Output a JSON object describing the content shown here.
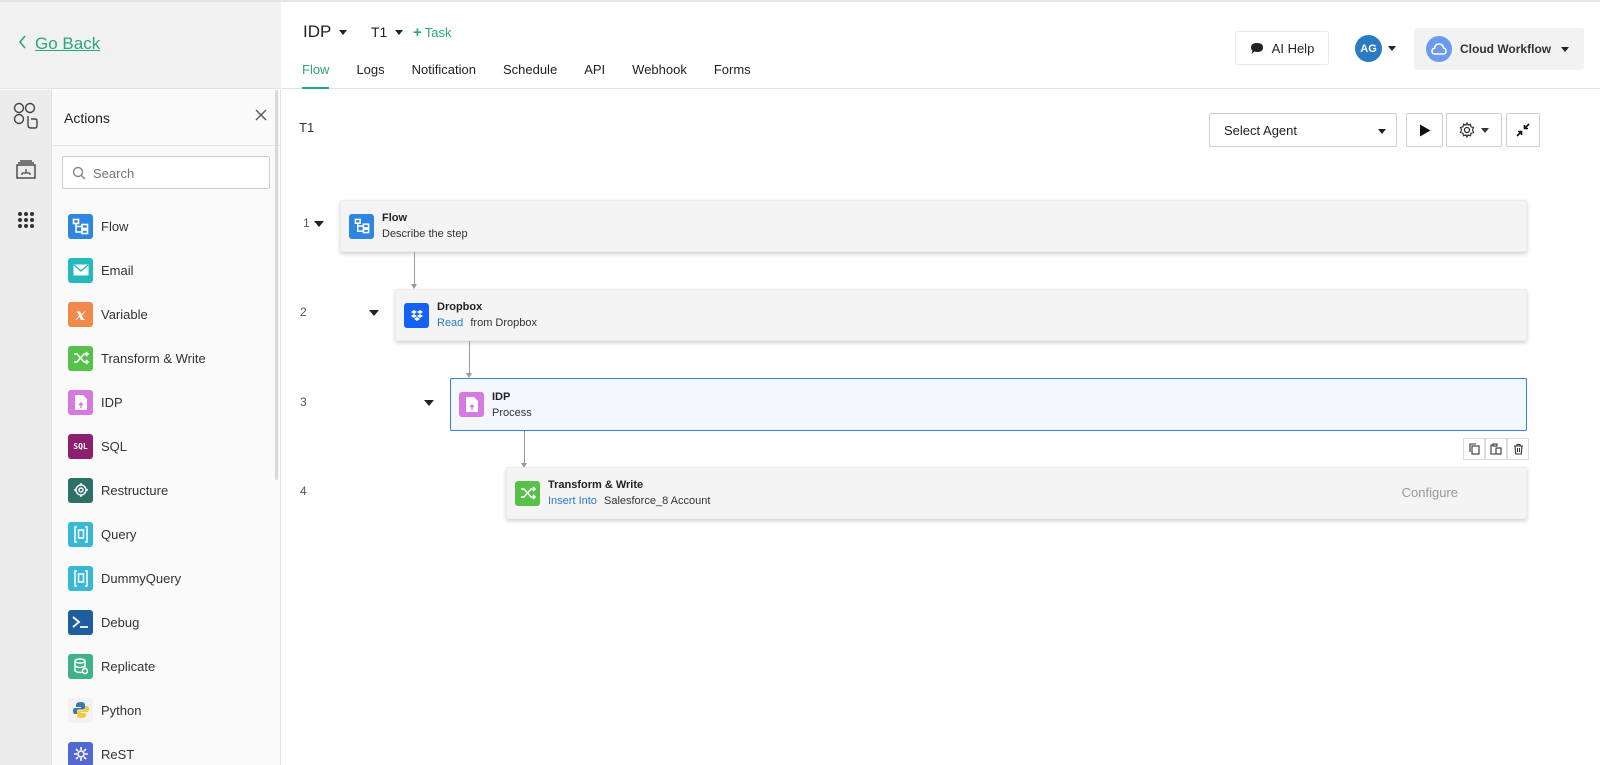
{
  "nav": {
    "go_back": "Go Back"
  },
  "header": {
    "title": "IDP",
    "task_selector": "T1",
    "add_task_label": "Task",
    "tabs": [
      {
        "label": "Flow"
      },
      {
        "label": "Logs"
      },
      {
        "label": "Notification"
      },
      {
        "label": "Schedule"
      },
      {
        "label": "API"
      },
      {
        "label": "Webhook"
      },
      {
        "label": "Forms"
      }
    ],
    "active_tab": "Flow",
    "ai_help": "AI Help",
    "avatar_initials": "AG",
    "workspace": "Cloud Workflow"
  },
  "panel": {
    "title": "Actions",
    "search_placeholder": "Search",
    "actions": [
      {
        "label": "Flow",
        "icon": "flow-icon",
        "color": "#2f86e0"
      },
      {
        "label": "Email",
        "icon": "email-icon",
        "color": "#23b9bd"
      },
      {
        "label": "Variable",
        "icon": "variable-icon",
        "color": "#f0894a"
      },
      {
        "label": "Transform & Write",
        "icon": "transform-icon",
        "color": "#57c14a"
      },
      {
        "label": "IDP",
        "icon": "idp-icon",
        "color": "#d679e0"
      },
      {
        "label": "SQL",
        "icon": "sql-icon",
        "color": "#8e1f6f"
      },
      {
        "label": "Restructure",
        "icon": "restructure-icon",
        "color": "#2e6f67"
      },
      {
        "label": "Query",
        "icon": "query-icon",
        "color": "#3bb7d6"
      },
      {
        "label": "DummyQuery",
        "icon": "dummy-query-icon",
        "color": "#3bb7d6"
      },
      {
        "label": "Debug",
        "icon": "debug-icon",
        "color": "#1f5e9e"
      },
      {
        "label": "Replicate",
        "icon": "replicate-icon",
        "color": "#3fb28a"
      },
      {
        "label": "Python",
        "icon": "python-icon",
        "color": "#f2f2f2"
      },
      {
        "label": "ReST",
        "icon": "rest-icon",
        "color": "#5468d4"
      }
    ]
  },
  "canvas": {
    "title": "T1",
    "agent_select": "Select Agent",
    "steps": [
      {
        "num": "1",
        "title": "Flow",
        "link": "",
        "subtitle": "Describe the step"
      },
      {
        "num": "2",
        "title": "Dropbox",
        "link": "Read",
        "subtitle": "from Dropbox"
      },
      {
        "num": "3",
        "title": "IDP",
        "link": "",
        "subtitle": "Process"
      },
      {
        "num": "4",
        "title": "Transform & Write",
        "link": "Insert Into",
        "subtitle": "Salesforce_8  Account",
        "action": "Configure"
      }
    ]
  }
}
